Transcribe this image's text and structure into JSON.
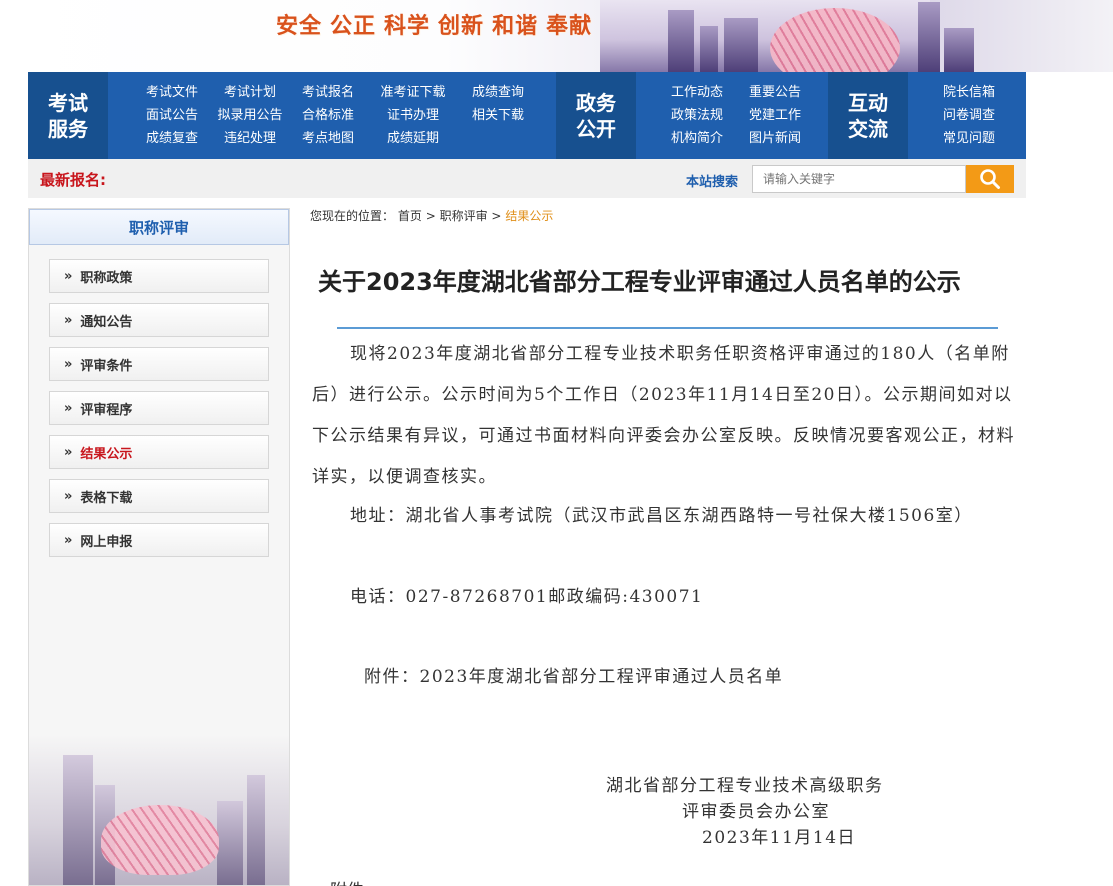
{
  "banner": {
    "slogan": [
      "安全",
      "公正",
      "科学",
      "创新",
      "和谐",
      "奉献"
    ]
  },
  "nav": {
    "exam_service": {
      "title": "考试服务",
      "links": [
        "考试文件",
        "考试计划",
        "考试报名",
        "准考证下载",
        "成绩查询",
        "面试公告",
        "拟录用公告",
        "合格标准",
        "证书办理",
        "相关下载",
        "成绩复查",
        "违纪处理",
        "考点地图",
        "成绩延期"
      ]
    },
    "gov_open": {
      "title": "政务公开",
      "links": [
        "工作动态",
        "重要公告",
        "政策法规",
        "党建工作",
        "机构简介",
        "图片新闻"
      ]
    },
    "interaction": {
      "title": "互动交流",
      "links": [
        "院长信箱",
        "问卷调查",
        "常见问题"
      ]
    }
  },
  "strip": {
    "latest_label": "最新报名:",
    "search_label": "本站搜索",
    "search_placeholder": "请输入关键字"
  },
  "sidebar": {
    "title": "职称评审",
    "items": [
      {
        "label": "职称政策",
        "active": false
      },
      {
        "label": "通知公告",
        "active": false
      },
      {
        "label": "评审条件",
        "active": false
      },
      {
        "label": "评审程序",
        "active": false
      },
      {
        "label": "结果公示",
        "active": true
      },
      {
        "label": "表格下载",
        "active": false
      },
      {
        "label": "网上申报",
        "active": false
      }
    ]
  },
  "breadcrumb": {
    "prefix": "您现在的位置：",
    "home": "首页",
    "sep": ">",
    "section": "职称评审",
    "current": "结果公示"
  },
  "article": {
    "title": "关于2023年度湖北省部分工程专业评审通过人员名单的公示",
    "para1": "现将2023年度湖北省部分工程专业技术职务任职资格评审通过的180人（名单附后）进行公示。公示时间为5个工作日（2023年11月14日至20日）。公示期间如对以下公示结果有异议，可通过书面材料向评委会办公室反映。反映情况要客观公正，材料详实，以便调查核实。",
    "address": "地址：湖北省人事考试院（武汉市武昌区东湖西路特一号社保大楼1506室）",
    "phone": "电话：027-87268701邮政编码:430071",
    "attachment": "附件：2023年度湖北省部分工程评审通过人员名单",
    "signer_line1": "湖北省部分工程专业技术高级职务",
    "signer_line2": "评审委员会办公室",
    "date": "2023年11月14日",
    "cut_text": "附件"
  },
  "colors": {
    "nav_blue": "#1f5fae",
    "nav_dark": "#17508f",
    "alert_red": "#c8161d",
    "search_orange": "#f39a16",
    "crumb_orange": "#e0901b",
    "title_rule": "#5b9bd5"
  },
  "icons": {
    "search": "magnifier-icon",
    "side_arrow": "double-chevron-right-icon"
  }
}
